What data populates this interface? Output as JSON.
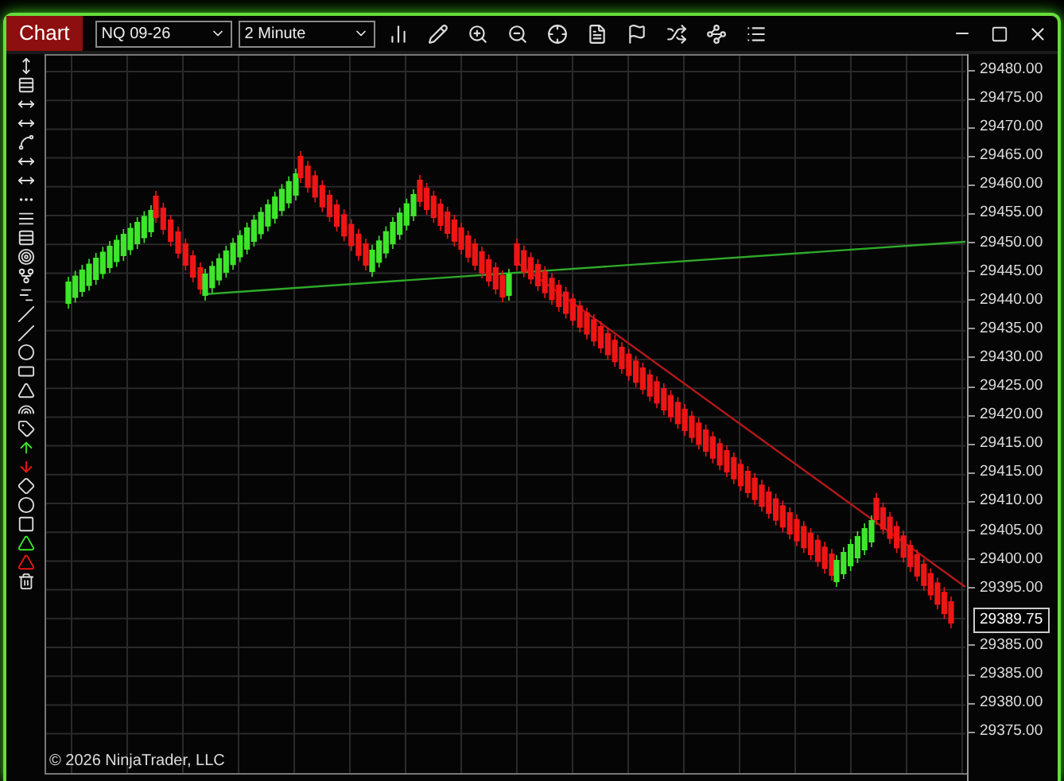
{
  "window": {
    "title": "Chart"
  },
  "toolbar": {
    "instrument": "NQ 09-26",
    "interval": "2 Minute"
  },
  "price_axis": {
    "labels": [
      {
        "text": "29480.00",
        "kind": "tick"
      },
      {
        "text": "29475.00",
        "kind": "tick"
      },
      {
        "text": "29470.00",
        "kind": "tick"
      },
      {
        "text": "29465.00",
        "kind": "tick"
      },
      {
        "text": "29460.00",
        "kind": "tick"
      },
      {
        "text": "29455.00",
        "kind": "tick"
      },
      {
        "text": "29450.00",
        "kind": "tick"
      },
      {
        "text": "29445.00",
        "kind": "tick"
      },
      {
        "text": "29440.00",
        "kind": "tick"
      },
      {
        "text": "29435.00",
        "kind": "tick"
      },
      {
        "text": "29430.00",
        "kind": "tick"
      },
      {
        "text": "29425.00",
        "kind": "tick"
      },
      {
        "text": "29420.00",
        "kind": "tick"
      },
      {
        "text": "29415.00",
        "kind": "tick"
      },
      {
        "text": "29415.00",
        "kind": "tick"
      },
      {
        "text": "29410.00",
        "kind": "tick"
      },
      {
        "text": "29405.00",
        "kind": "tick"
      },
      {
        "text": "29400.00",
        "kind": "tick"
      },
      {
        "text": "29395.00",
        "kind": "tick"
      },
      {
        "text": "29389.75",
        "kind": "current"
      },
      {
        "text": "29385.00",
        "kind": "tick"
      },
      {
        "text": "29385.00",
        "kind": "tick"
      },
      {
        "text": "29380.00",
        "kind": "tick"
      },
      {
        "text": "29375.00",
        "kind": "tick"
      }
    ]
  },
  "copyright": "© 2026 NinjaTrader, LLC"
}
